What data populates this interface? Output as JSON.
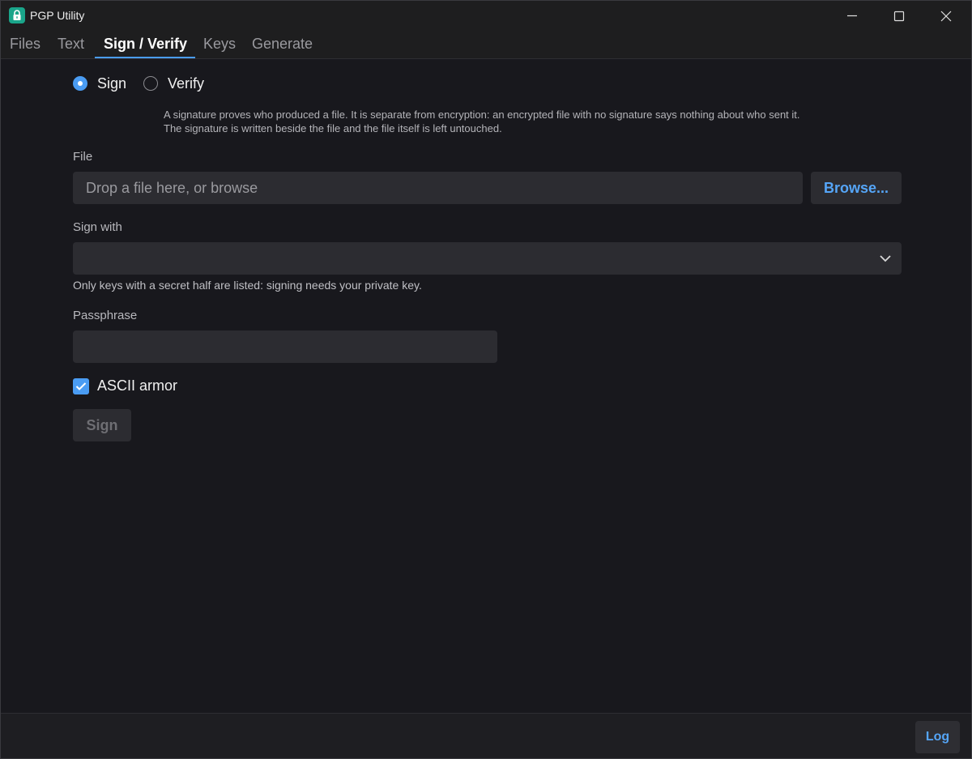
{
  "window": {
    "title": "PGP Utility",
    "icon": "lock-icon"
  },
  "tabs": [
    {
      "label": "Files",
      "active": false
    },
    {
      "label": "Text",
      "active": false
    },
    {
      "label": "Sign / Verify",
      "active": true
    },
    {
      "label": "Keys",
      "active": false
    },
    {
      "label": "Generate",
      "active": false
    }
  ],
  "mode": {
    "options": [
      {
        "label": "Sign",
        "selected": true
      },
      {
        "label": "Verify",
        "selected": false
      }
    ],
    "description": "A signature proves who produced a file. It is separate from encryption: an encrypted file with no signature says nothing about who sent it. The signature is written beside the file and the file itself is left untouched."
  },
  "file": {
    "label": "File",
    "placeholder": "Drop a file here, or browse",
    "browse_label": "Browse..."
  },
  "sign_with": {
    "label": "Sign with",
    "value": "",
    "hint": "Only keys with a secret half are listed: signing needs your private key."
  },
  "passphrase": {
    "label": "Passphrase",
    "value": ""
  },
  "ascii_armor": {
    "label": "ASCII armor",
    "checked": true
  },
  "actions": {
    "sign_label": "Sign",
    "sign_enabled": false
  },
  "footer": {
    "log_label": "Log"
  },
  "colors": {
    "accent": "#4a9cf3",
    "link": "#55a5f7",
    "background": "#18181d",
    "field": "#2c2c31",
    "app_icon": "#1aa58a"
  }
}
